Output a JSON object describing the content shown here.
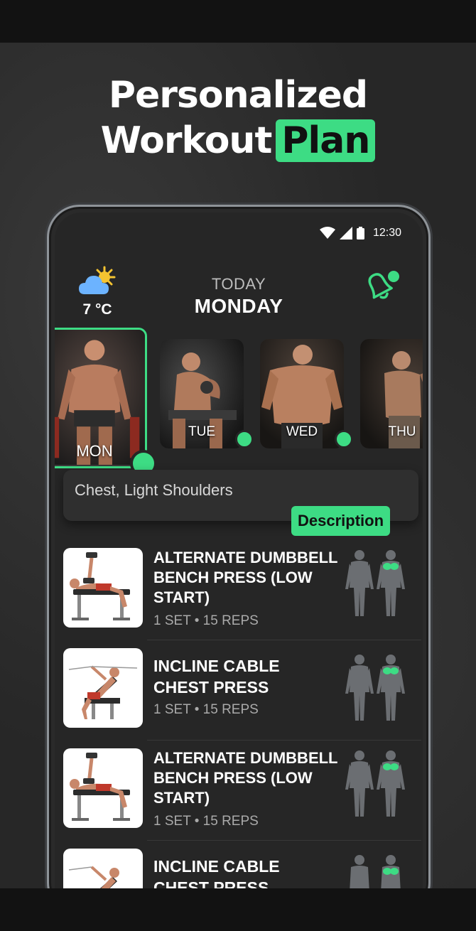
{
  "headline": {
    "line1": "Personalized",
    "line2": "Workout",
    "highlight": "Plan"
  },
  "status_bar": {
    "time": "12:30",
    "icons": [
      "wifi-icon",
      "signal-icon",
      "battery-icon"
    ]
  },
  "header": {
    "weather_icon": "partly-cloudy-icon",
    "temperature": "7 °C",
    "today_label": "TODAY",
    "day": "MONDAY",
    "bell_icon": "bell-icon"
  },
  "days": [
    {
      "label": "MON",
      "active": true,
      "done": true
    },
    {
      "label": "TUE",
      "active": false,
      "done": true
    },
    {
      "label": "WED",
      "active": false,
      "done": true
    },
    {
      "label": "THU",
      "active": false,
      "done": false
    }
  ],
  "focus": {
    "muscles": "Chest, Light Shoulders",
    "description_label": "Description"
  },
  "exercises": [
    {
      "name": "ALTERNATE DUMBBELL BENCH PRESS (LOW START)",
      "meta": "1 SET • 15 REPS",
      "illustration": "dumbbell-bench-press"
    },
    {
      "name": "INCLINE CABLE CHEST PRESS",
      "meta": "1 SET • 15 REPS",
      "illustration": "incline-cable-chest-press"
    },
    {
      "name": "ALTERNATE DUMBBELL BENCH PRESS (LOW START)",
      "meta": "1 SET • 15 REPS",
      "illustration": "dumbbell-bench-press"
    },
    {
      "name": "INCLINE CABLE CHEST PRESS",
      "meta": "",
      "illustration": "incline-cable-chest-press"
    }
  ],
  "colors": {
    "accent": "#3ddc84",
    "background": "#262626",
    "muscle_highlight": "#3ddc84"
  }
}
